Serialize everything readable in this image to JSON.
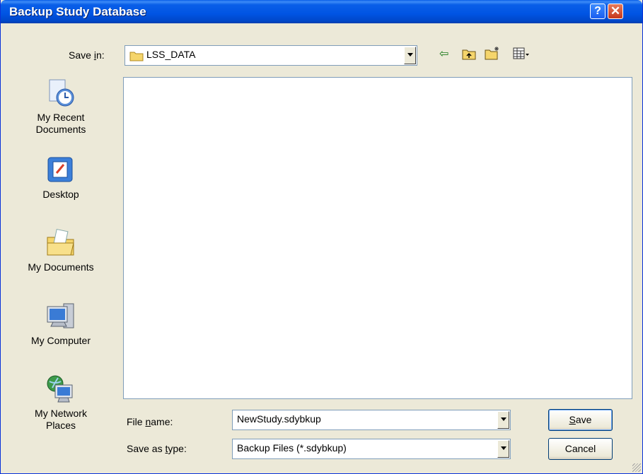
{
  "window": {
    "title": "Backup Study Database"
  },
  "title_buttons": {
    "help": "?",
    "close": "✕"
  },
  "save_in": {
    "label_pre": "Save ",
    "label_u": "i",
    "label_post": "n:",
    "value": "LSS_DATA"
  },
  "toolbar": {
    "back": "⇦",
    "up": "⬆",
    "new_folder": "✱",
    "view": "▦▾"
  },
  "places": [
    {
      "label_line1": "My Recent",
      "label_line2": "Documents",
      "icon": "recent-documents-icon"
    },
    {
      "label_line1": "Desktop",
      "label_line2": "",
      "icon": "desktop-icon"
    },
    {
      "label_line1": "My Documents",
      "label_line2": "",
      "icon": "my-documents-icon"
    },
    {
      "label_line1": "My Computer",
      "label_line2": "",
      "icon": "my-computer-icon"
    },
    {
      "label_line1": "My Network",
      "label_line2": "Places",
      "icon": "network-places-icon"
    }
  ],
  "filename": {
    "label_pre": "File ",
    "label_u": "n",
    "label_post": "ame:",
    "value": "NewStudy.sdybkup"
  },
  "filetype": {
    "label_pre": "Save as ",
    "label_u": "t",
    "label_post": "ype:",
    "value": "Backup Files (*.sdybkup)"
  },
  "buttons": {
    "save_u": "S",
    "save_rest": "ave",
    "cancel": "Cancel"
  },
  "colors": {
    "title_bar": "#0054e3",
    "dialog_bg": "#ece9d8",
    "field_border": "#7f9db9"
  }
}
